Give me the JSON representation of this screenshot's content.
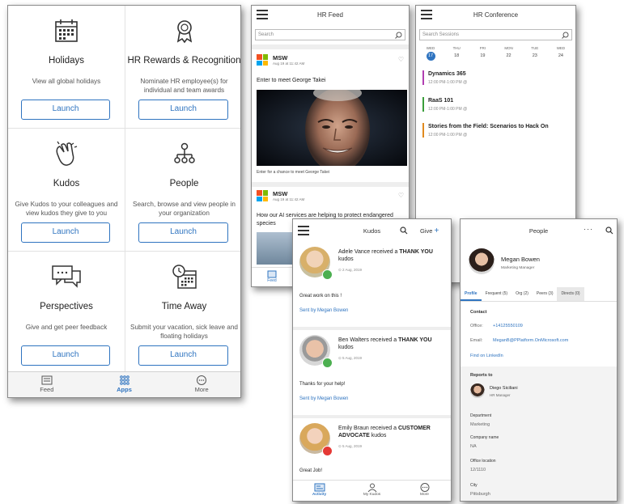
{
  "apps_screen": {
    "tiles": [
      {
        "title": "Holidays",
        "description": "View all global holidays",
        "button": "Launch",
        "icon": "calendar-icon"
      },
      {
        "title": "HR Rewards & Recognition",
        "description": "Nominate HR employee(s) for individual and team awards",
        "button": "Launch",
        "icon": "award-icon"
      },
      {
        "title": "Kudos",
        "description": "Give Kudos to your colleagues and view kudos they give to you",
        "button": "Launch",
        "icon": "clap-icon"
      },
      {
        "title": "People",
        "description": "Search, browse and view people in your organization",
        "button": "Launch",
        "icon": "org-chart-icon"
      },
      {
        "title": "Perspectives",
        "description": "Give and get peer feedback",
        "button": "Launch",
        "icon": "chat-bubbles-icon"
      },
      {
        "title": "Time Away",
        "description": "Submit your vacation, sick leave and floating holidays",
        "button": "Launch",
        "icon": "calendar-clock-icon"
      }
    ],
    "nav": {
      "feed": "Feed",
      "apps": "Apps",
      "more": "More"
    }
  },
  "hr_feed": {
    "title": "HR Feed",
    "search_placeholder": "Search",
    "post1": {
      "author": "MSW",
      "date": "Aug 19 at 11:42 AM",
      "text": "Enter to meet George Takei",
      "caption": "Enter for a chance to meet George Takei"
    },
    "post2": {
      "author": "MSW",
      "date": "Aug 19 at 11:42 AM",
      "text": "How our AI services are helping to protect endangered species"
    },
    "nav_feed": "Feed"
  },
  "hr_conference": {
    "title": "HR Conference",
    "search_placeholder": "Search Sessions",
    "days": [
      {
        "dow": "WED",
        "num": "17"
      },
      {
        "dow": "THU",
        "num": "18"
      },
      {
        "dow": "FRI",
        "num": "19"
      },
      {
        "dow": "MON",
        "num": "22"
      },
      {
        "dow": "TUE",
        "num": "23"
      },
      {
        "dow": "WED",
        "num": "24"
      }
    ],
    "sessions": [
      {
        "title": "Dynamics 365",
        "time": "12:00 PM-1:00 PM @",
        "color": "#b13fb1"
      },
      {
        "title": "RaaS 101",
        "time": "12:00 PM-1:00 PM @",
        "color": "#3a9e3a"
      },
      {
        "title": "Stories from the Field: Scenarios to Hack On",
        "time": "12:00 PM-1:00 PM @",
        "color": "#e08a1e"
      }
    ]
  },
  "kudos": {
    "title": "Kudos",
    "give_label": "Give",
    "items": [
      {
        "name": "Adele Vance",
        "received": "received a",
        "kind": "THANK YOU",
        "suffix": "kudos",
        "date": "2 Aug, 2019",
        "message": "Great work on this !",
        "sent_by": "Sent by Megan Bowen",
        "badge_color": "#4caf50"
      },
      {
        "name": "Ben Walters",
        "received": "received a",
        "kind": "THANK YOU",
        "suffix": "kudos",
        "date": "5 Aug, 2019",
        "message": "Thanks for your help!",
        "sent_by": "Sent by Megan Bowen",
        "badge_color": "#4caf50"
      },
      {
        "name": "Emily Braun",
        "received": "received a",
        "kind": "CUSTOMER ADVOCATE",
        "suffix": "kudos",
        "date": "5 Aug, 2019",
        "message": "Great Job!",
        "sent_by": "",
        "badge_color": "#e53935"
      }
    ],
    "nav": {
      "activity": "Activity",
      "my_kudos": "My Kudos",
      "more": "More"
    }
  },
  "people": {
    "title": "People",
    "name": "Megan Bowen",
    "role": "Marketing Manager",
    "tabs": [
      "Profile",
      "Frequent (5)",
      "Org (2)",
      "Peers (3)",
      "Directs (0)"
    ],
    "contact_heading": "Contact",
    "office_label": "Office:",
    "office_value": "+14125550109",
    "email_label": "Email:",
    "email_value": "MeganB@PPlatform.OnMicrosoft.com",
    "linkedin": "Find on LinkedIn",
    "reports_to_label": "Reports to",
    "manager_name": "Diego Siciliani",
    "manager_role": "HR Manager",
    "department_label": "Department",
    "department_value": "Marketing",
    "company_label": "Company name",
    "company_value": "NA",
    "office_location_label": "Office location",
    "office_location_value": "12/1110",
    "city_label": "City",
    "city_value": "Pittsburgh"
  },
  "colors": {
    "accent": "#2f74c0",
    "ms_red": "#f25022",
    "ms_green": "#7fba00",
    "ms_blue": "#00a4ef",
    "ms_yellow": "#ffb900"
  }
}
